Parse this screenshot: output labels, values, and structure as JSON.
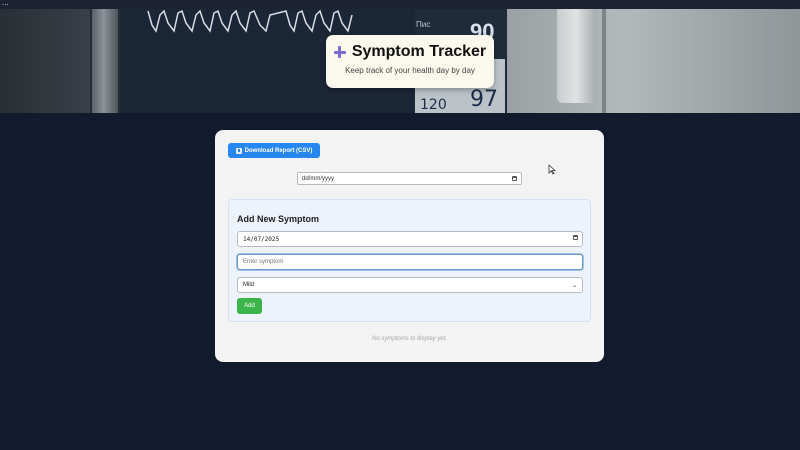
{
  "window": {
    "corner_glyph": "..."
  },
  "hero": {
    "title": "Symptom Tracker",
    "subtitle": "Keep track of your health day by day",
    "icon": "plus-icon",
    "monitor_readouts": {
      "label": "Пис",
      "pulse": "90",
      "bp": "120",
      "spo2": "97"
    }
  },
  "toolbar": {
    "download_label": "Download Report (CSV)",
    "download_icon": "download-icon"
  },
  "filter": {
    "date_placeholder": "dd/mm/yyyy"
  },
  "form": {
    "title": "Add New Symptom",
    "date_value": "14/07/2025",
    "symptom_placeholder": "Enter symptom",
    "severity_selected": "Mild",
    "add_label": "Add"
  },
  "list": {
    "empty_message": "No symptoms to display yet."
  },
  "colors": {
    "page_bg": "#121a2e",
    "panel_bg": "#f3f3f3",
    "primary_button": "#2687f0",
    "add_button": "#3bb54a",
    "title_card_bg": "#fbf8ee",
    "accent_plus": "#7a6bd0"
  }
}
